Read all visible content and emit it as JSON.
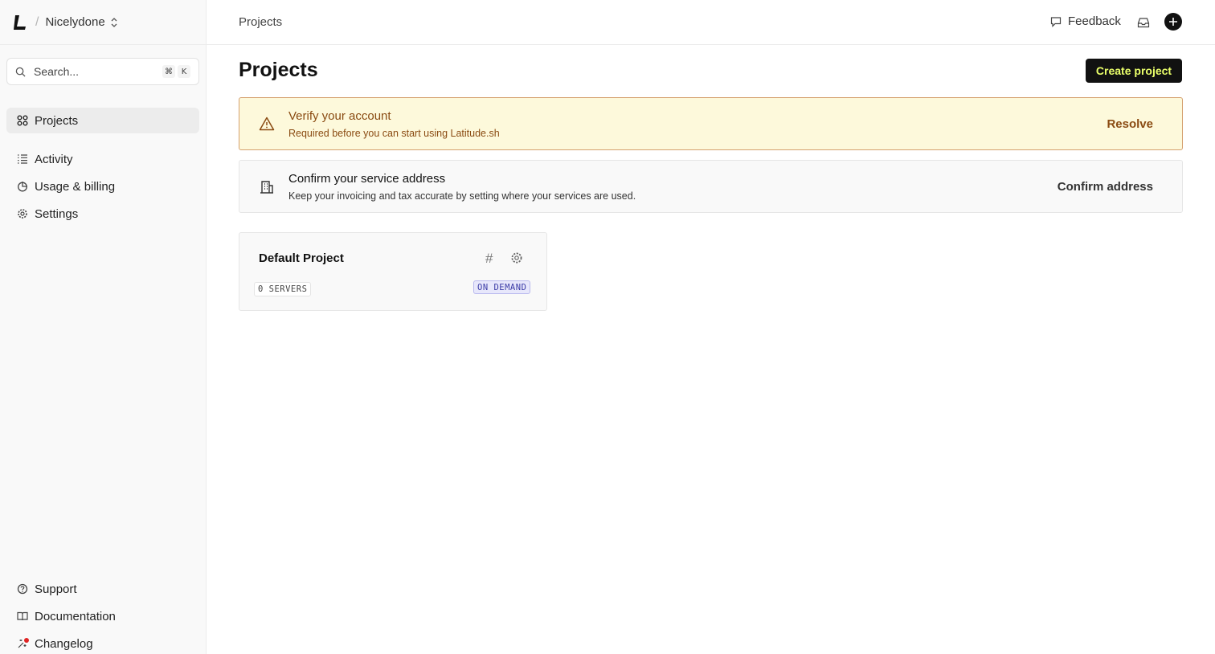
{
  "sidebar": {
    "org_name": "Nicelydone",
    "search": {
      "placeholder": "Search...",
      "shortcut_key_1": "⌘",
      "shortcut_key_2": "K"
    },
    "items": [
      {
        "label": "Projects",
        "icon": "grid-icon",
        "active": true
      },
      {
        "label": "Activity",
        "icon": "list-icon"
      },
      {
        "label": "Usage & billing",
        "icon": "pie-icon"
      },
      {
        "label": "Settings",
        "icon": "gear-icon"
      }
    ],
    "footer_items": [
      {
        "label": "Support",
        "icon": "help-circle-icon"
      },
      {
        "label": "Documentation",
        "icon": "book-icon"
      },
      {
        "label": "Changelog",
        "icon": "sparkle-icon"
      }
    ]
  },
  "topbar": {
    "breadcrumb": "Projects",
    "feedback_label": "Feedback"
  },
  "main": {
    "title": "Projects",
    "create_button": "Create project",
    "verify_banner": {
      "title": "Verify your account",
      "subtitle": "Required before you can start using Latitude.sh",
      "action": "Resolve"
    },
    "address_banner": {
      "title": "Confirm your service address",
      "subtitle": "Keep your invoicing and tax accurate by setting where your services are used.",
      "action": "Confirm address"
    },
    "projects": [
      {
        "name": "Default Project",
        "servers": "0 SERVERS",
        "plan": "ON DEMAND"
      }
    ]
  },
  "colors": {
    "accent_text": "#eaff6a",
    "warn_bg": "#fdf9db",
    "warn_border": "#d5a06e",
    "warn_text": "#8a4b12",
    "plan_tag_text": "#3b3ba6",
    "plan_tag_bg": "#e7e7fb"
  }
}
